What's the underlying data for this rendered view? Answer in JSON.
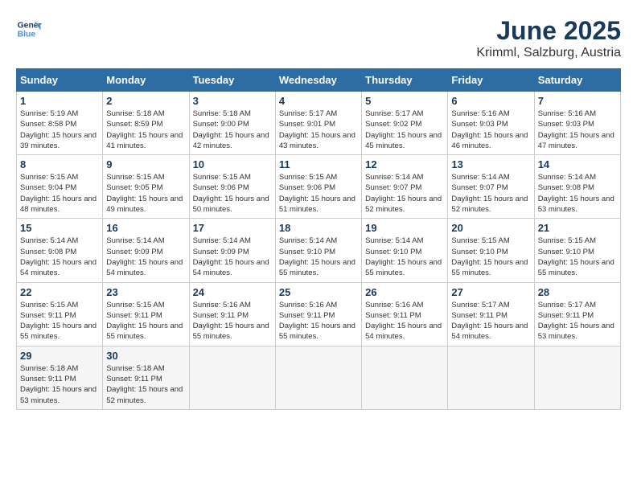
{
  "logo": {
    "line1": "General",
    "line2": "Blue"
  },
  "title": "June 2025",
  "subtitle": "Krimml, Salzburg, Austria",
  "headers": [
    "Sunday",
    "Monday",
    "Tuesday",
    "Wednesday",
    "Thursday",
    "Friday",
    "Saturday"
  ],
  "weeks": [
    [
      {
        "day": "1",
        "sunrise": "5:19 AM",
        "sunset": "8:58 PM",
        "daylight": "15 hours and 39 minutes."
      },
      {
        "day": "2",
        "sunrise": "5:18 AM",
        "sunset": "8:59 PM",
        "daylight": "15 hours and 41 minutes."
      },
      {
        "day": "3",
        "sunrise": "5:18 AM",
        "sunset": "9:00 PM",
        "daylight": "15 hours and 42 minutes."
      },
      {
        "day": "4",
        "sunrise": "5:17 AM",
        "sunset": "9:01 PM",
        "daylight": "15 hours and 43 minutes."
      },
      {
        "day": "5",
        "sunrise": "5:17 AM",
        "sunset": "9:02 PM",
        "daylight": "15 hours and 45 minutes."
      },
      {
        "day": "6",
        "sunrise": "5:16 AM",
        "sunset": "9:03 PM",
        "daylight": "15 hours and 46 minutes."
      },
      {
        "day": "7",
        "sunrise": "5:16 AM",
        "sunset": "9:03 PM",
        "daylight": "15 hours and 47 minutes."
      }
    ],
    [
      {
        "day": "8",
        "sunrise": "5:15 AM",
        "sunset": "9:04 PM",
        "daylight": "15 hours and 48 minutes."
      },
      {
        "day": "9",
        "sunrise": "5:15 AM",
        "sunset": "9:05 PM",
        "daylight": "15 hours and 49 minutes."
      },
      {
        "day": "10",
        "sunrise": "5:15 AM",
        "sunset": "9:06 PM",
        "daylight": "15 hours and 50 minutes."
      },
      {
        "day": "11",
        "sunrise": "5:15 AM",
        "sunset": "9:06 PM",
        "daylight": "15 hours and 51 minutes."
      },
      {
        "day": "12",
        "sunrise": "5:14 AM",
        "sunset": "9:07 PM",
        "daylight": "15 hours and 52 minutes."
      },
      {
        "day": "13",
        "sunrise": "5:14 AM",
        "sunset": "9:07 PM",
        "daylight": "15 hours and 52 minutes."
      },
      {
        "day": "14",
        "sunrise": "5:14 AM",
        "sunset": "9:08 PM",
        "daylight": "15 hours and 53 minutes."
      }
    ],
    [
      {
        "day": "15",
        "sunrise": "5:14 AM",
        "sunset": "9:08 PM",
        "daylight": "15 hours and 54 minutes."
      },
      {
        "day": "16",
        "sunrise": "5:14 AM",
        "sunset": "9:09 PM",
        "daylight": "15 hours and 54 minutes."
      },
      {
        "day": "17",
        "sunrise": "5:14 AM",
        "sunset": "9:09 PM",
        "daylight": "15 hours and 54 minutes."
      },
      {
        "day": "18",
        "sunrise": "5:14 AM",
        "sunset": "9:10 PM",
        "daylight": "15 hours and 55 minutes."
      },
      {
        "day": "19",
        "sunrise": "5:14 AM",
        "sunset": "9:10 PM",
        "daylight": "15 hours and 55 minutes."
      },
      {
        "day": "20",
        "sunrise": "5:15 AM",
        "sunset": "9:10 PM",
        "daylight": "15 hours and 55 minutes."
      },
      {
        "day": "21",
        "sunrise": "5:15 AM",
        "sunset": "9:10 PM",
        "daylight": "15 hours and 55 minutes."
      }
    ],
    [
      {
        "day": "22",
        "sunrise": "5:15 AM",
        "sunset": "9:11 PM",
        "daylight": "15 hours and 55 minutes."
      },
      {
        "day": "23",
        "sunrise": "5:15 AM",
        "sunset": "9:11 PM",
        "daylight": "15 hours and 55 minutes."
      },
      {
        "day": "24",
        "sunrise": "5:16 AM",
        "sunset": "9:11 PM",
        "daylight": "15 hours and 55 minutes."
      },
      {
        "day": "25",
        "sunrise": "5:16 AM",
        "sunset": "9:11 PM",
        "daylight": "15 hours and 55 minutes."
      },
      {
        "day": "26",
        "sunrise": "5:16 AM",
        "sunset": "9:11 PM",
        "daylight": "15 hours and 54 minutes."
      },
      {
        "day": "27",
        "sunrise": "5:17 AM",
        "sunset": "9:11 PM",
        "daylight": "15 hours and 54 minutes."
      },
      {
        "day": "28",
        "sunrise": "5:17 AM",
        "sunset": "9:11 PM",
        "daylight": "15 hours and 53 minutes."
      }
    ],
    [
      {
        "day": "29",
        "sunrise": "5:18 AM",
        "sunset": "9:11 PM",
        "daylight": "15 hours and 53 minutes."
      },
      {
        "day": "30",
        "sunrise": "5:18 AM",
        "sunset": "9:11 PM",
        "daylight": "15 hours and 52 minutes."
      },
      null,
      null,
      null,
      null,
      null
    ]
  ],
  "labels": {
    "sunrise": "Sunrise: ",
    "sunset": "Sunset: ",
    "daylight": "Daylight: "
  }
}
